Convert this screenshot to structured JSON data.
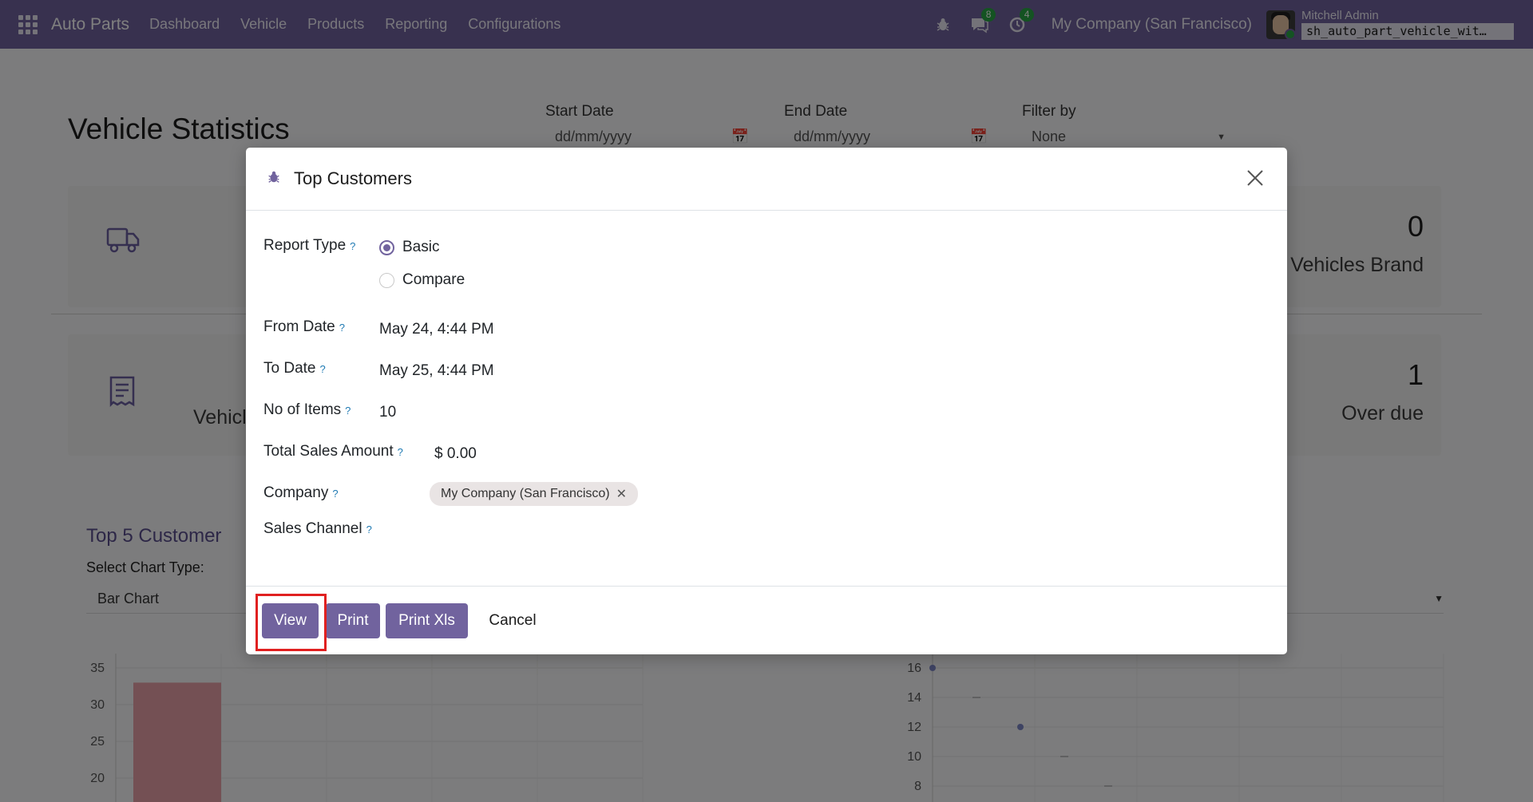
{
  "navbar": {
    "brand": "Auto Parts",
    "menu": [
      "Dashboard",
      "Vehicle",
      "Products",
      "Reporting",
      "Configurations"
    ],
    "messages_count": "8",
    "activities_count": "4",
    "company": "My Company (San Francisco)",
    "user_name": "Mitchell Admin",
    "db_name": "sh_auto_part_vehicle_wit…"
  },
  "page": {
    "title": "Vehicle Statistics",
    "filters": {
      "start_label": "Start Date",
      "start_placeholder": "dd/mm/yyyy",
      "end_label": "End Date",
      "end_placeholder": "dd/mm/yyyy",
      "filter_by_label": "Filter by",
      "filter_by_value": "None"
    },
    "cards": [
      {
        "value": "0",
        "label": "Vehicles Brand"
      },
      {
        "value": "1",
        "label": "Over due",
        "left_label": "Vehicl"
      }
    ],
    "section_title": "Top 5 Customer",
    "chart_type_label": "Select Chart Type:",
    "chart_type_value": "Bar Chart"
  },
  "chart_data": [
    {
      "type": "bar",
      "y_ticks": [
        35,
        30,
        25,
        20
      ],
      "categories": [
        ""
      ],
      "values": [
        33
      ],
      "ylim": [
        20,
        35
      ],
      "color": "#e8a1a9"
    },
    {
      "type": "scatter",
      "y_ticks": [
        16,
        14,
        12,
        10,
        8
      ],
      "x": [
        0,
        1,
        2,
        3,
        4
      ],
      "y": [
        16,
        14,
        12,
        10,
        8
      ],
      "ylim": [
        8,
        16
      ],
      "color": "#7d86c7"
    }
  ],
  "modal": {
    "title": "Top Customers",
    "fields": {
      "report_type_label": "Report Type",
      "report_type_options": [
        "Basic",
        "Compare"
      ],
      "report_type_selected": "Basic",
      "from_date_label": "From Date",
      "from_date_value": "May 24, 4:44 PM",
      "to_date_label": "To Date",
      "to_date_value": "May 25, 4:44 PM",
      "items_label": "No of Items",
      "items_value": "10",
      "total_sales_label": "Total Sales Amount",
      "total_sales_value": "$ 0.00",
      "company_label": "Company",
      "company_tag": "My Company (San Francisco)",
      "sales_channel_label": "Sales Channel",
      "help_mark": "?"
    },
    "buttons": {
      "view": "View",
      "print": "Print",
      "print_xls": "Print Xls",
      "cancel": "Cancel"
    }
  },
  "colors": {
    "primary": "#71639e",
    "badge": "#28a745",
    "highlight": "#e02020"
  }
}
